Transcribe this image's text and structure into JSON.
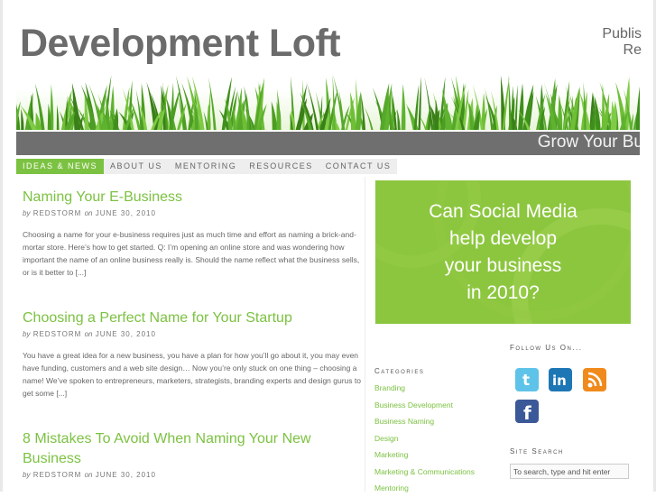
{
  "header": {
    "logo": "Development Loft",
    "tagline_line1": "Publis",
    "tagline_line2": "Re",
    "greybar_text": "Grow Your Bu"
  },
  "nav": {
    "items": [
      {
        "label": "IDEAS & NEWS",
        "active": true
      },
      {
        "label": "ABOUT US",
        "active": false
      },
      {
        "label": "MENTORING",
        "active": false
      },
      {
        "label": "RESOURCES",
        "active": false
      },
      {
        "label": "CONTACT US",
        "active": false
      }
    ]
  },
  "posts": [
    {
      "title": "Naming Your E-Business",
      "by": "by",
      "author": "REDSTORM",
      "on": "on",
      "date": "JUNE 30, 2010",
      "excerpt": "Choosing a name for your e-business requires just as much time and effort as naming a brick-and-mortar store. Here’s how to get started. Q: I’m opening an online store and was wondering how important the name of an online business really is. Should the name reflect what the business sells, or is it better to [...]"
    },
    {
      "title": "Choosing a Perfect Name for Your Startup",
      "by": "by",
      "author": "REDSTORM",
      "on": "on",
      "date": "JUNE 30, 2010",
      "excerpt": "You have a great idea for a new business, you have a plan for how you’ll go about it, you may even have funding, customers and a web site design… Now you’re only stuck on one thing – choosing a name! We’ve spoken to entrepreneurs, marketers, strategists, branding experts and design gurus to get some [...]"
    },
    {
      "title": "8 Mistakes To Avoid When Naming Your New Business",
      "by": "by",
      "author": "REDSTORM",
      "on": "on",
      "date": "JUNE 30, 2010",
      "excerpt": ""
    }
  ],
  "ad": {
    "line1": "Can Social Media",
    "line2": "help develop",
    "line3": "your business",
    "line4": "in 2010?"
  },
  "sidebar": {
    "follow_title": "Follow Us On...",
    "categories_title": "Categories",
    "categories": [
      "Branding",
      "Business Development",
      "Business Naming",
      "Design",
      "Marketing",
      "Marketing & Communications",
      "Mentoring"
    ],
    "search_title": "Site Search",
    "search_placeholder": "To search, type and hit enter",
    "social": [
      {
        "icon": "twitter-icon",
        "color": "#5ec3e8"
      },
      {
        "icon": "linkedin-icon",
        "color": "#1e77b5"
      },
      {
        "icon": "rss-icon",
        "color": "#f08a1c"
      },
      {
        "icon": "facebook-icon",
        "color": "#3b5998"
      }
    ]
  },
  "colors": {
    "accent": "#7cc242",
    "nav_active": "#7cc242",
    "greybar": "#6f6f6f"
  }
}
